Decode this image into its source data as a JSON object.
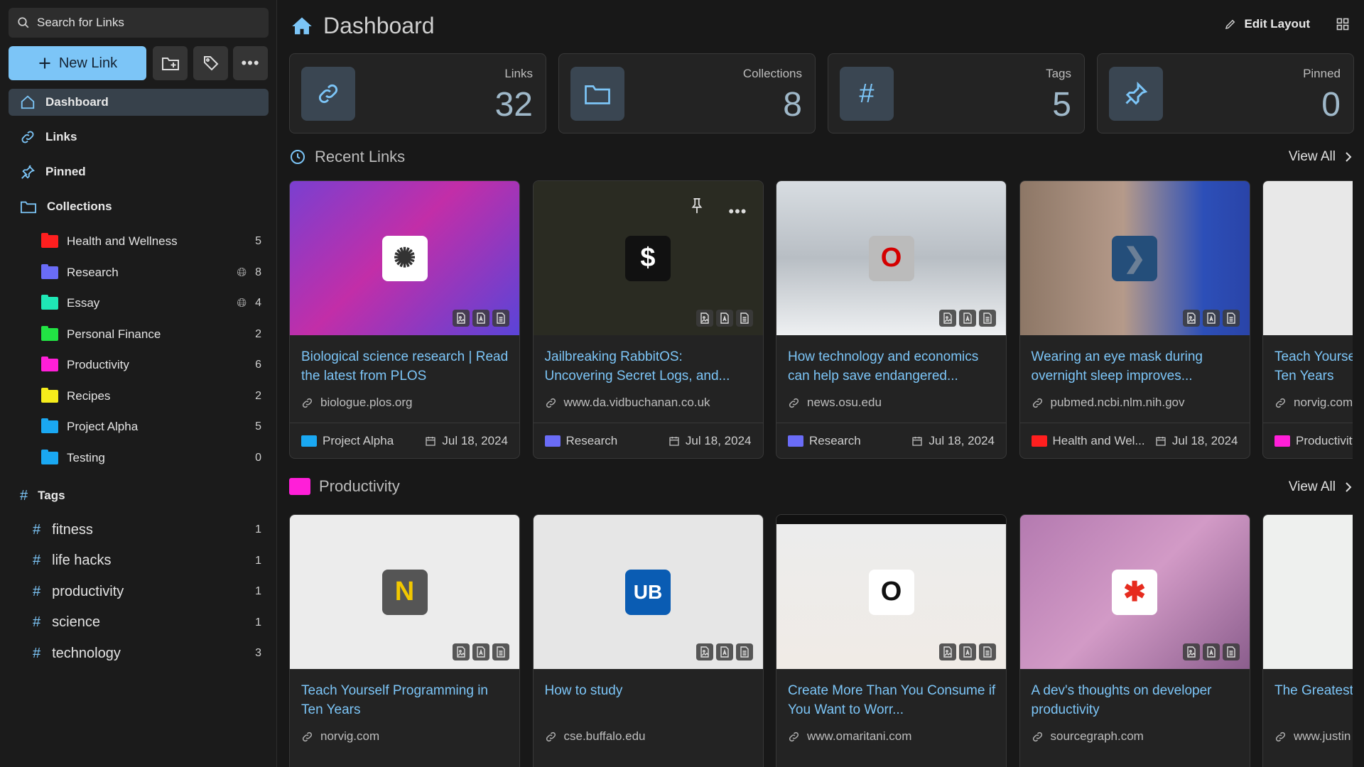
{
  "search": {
    "placeholder": "Search for Links"
  },
  "toolbar": {
    "new_link_label": "New Link"
  },
  "nav": {
    "dashboard": "Dashboard",
    "links": "Links",
    "pinned": "Pinned",
    "collections": "Collections",
    "tags": "Tags"
  },
  "collections": [
    {
      "name": "Health and Wellness",
      "count": "5",
      "color": "#ff1f1f",
      "public": false
    },
    {
      "name": "Research",
      "count": "8",
      "color": "#6a6cf7",
      "public": true
    },
    {
      "name": "Essay",
      "count": "4",
      "color": "#1fe8b6",
      "public": true
    },
    {
      "name": "Personal Finance",
      "count": "2",
      "color": "#22e444",
      "public": false
    },
    {
      "name": "Productivity",
      "count": "6",
      "color": "#ff1fd8",
      "public": false
    },
    {
      "name": "Recipes",
      "count": "2",
      "color": "#f5ec1b",
      "public": false
    },
    {
      "name": "Project Alpha",
      "count": "5",
      "color": "#1aa8f2",
      "public": false
    },
    {
      "name": "Testing",
      "count": "0",
      "color": "#1aa8f2",
      "public": false
    }
  ],
  "tags": [
    {
      "name": "fitness",
      "count": "1"
    },
    {
      "name": "life hacks",
      "count": "1"
    },
    {
      "name": "productivity",
      "count": "1"
    },
    {
      "name": "science",
      "count": "1"
    },
    {
      "name": "technology",
      "count": "3"
    }
  ],
  "header": {
    "title": "Dashboard",
    "edit_layout": "Edit Layout"
  },
  "stats": [
    {
      "label": "Links",
      "value": "32",
      "icon": "link-icon"
    },
    {
      "label": "Collections",
      "value": "8",
      "icon": "folder-icon"
    },
    {
      "label": "Tags",
      "value": "5",
      "icon": "hash-icon"
    },
    {
      "label": "Pinned",
      "value": "0",
      "icon": "pin-icon"
    }
  ],
  "recent": {
    "title": "Recent Links",
    "view_all": "View All",
    "cards": [
      {
        "title": "Biological science research | Read the latest from PLOS",
        "domain": "biologue.plos.org",
        "collection": "Project Alpha",
        "collection_color": "#1aa8f2",
        "date": "Jul 18, 2024"
      },
      {
        "title": "Jailbreaking RabbitOS: Uncovering Secret Logs, and...",
        "domain": "www.da.vidbuchanan.co.uk",
        "collection": "Research",
        "collection_color": "#6a6cf7",
        "date": "Jul 18, 2024"
      },
      {
        "title": "How technology and economics can help save endangered...",
        "domain": "news.osu.edu",
        "collection": "Research",
        "collection_color": "#6a6cf7",
        "date": "Jul 18, 2024"
      },
      {
        "title": "Wearing an eye mask during overnight sleep improves...",
        "domain": "pubmed.ncbi.nlm.nih.gov",
        "collection": "Health and Wel...",
        "collection_color": "#ff1f1f",
        "date": "Jul 18, 2024"
      },
      {
        "title": "Teach Yourself Programming in Ten Years",
        "domain": "norvig.com",
        "collection": "Productivity",
        "collection_color": "#ff1fd8",
        "date": ""
      }
    ]
  },
  "productivity": {
    "title": "Productivity",
    "view_all": "View All",
    "cards": [
      {
        "title": "Teach Yourself Programming in Ten Years",
        "domain": "norvig.com"
      },
      {
        "title": "How to study",
        "domain": "cse.buffalo.edu"
      },
      {
        "title": "Create More Than You Consume if You Want to Worr...",
        "domain": "www.omaritani.com"
      },
      {
        "title": "A dev's thoughts on developer productivity",
        "domain": "sourcegraph.com"
      },
      {
        "title": "The Greatest Hack: Learning",
        "domain": "www.justin"
      }
    ]
  },
  "colors": {
    "accent": "#7cc5f7",
    "background": "#181818",
    "card": "#232323"
  }
}
